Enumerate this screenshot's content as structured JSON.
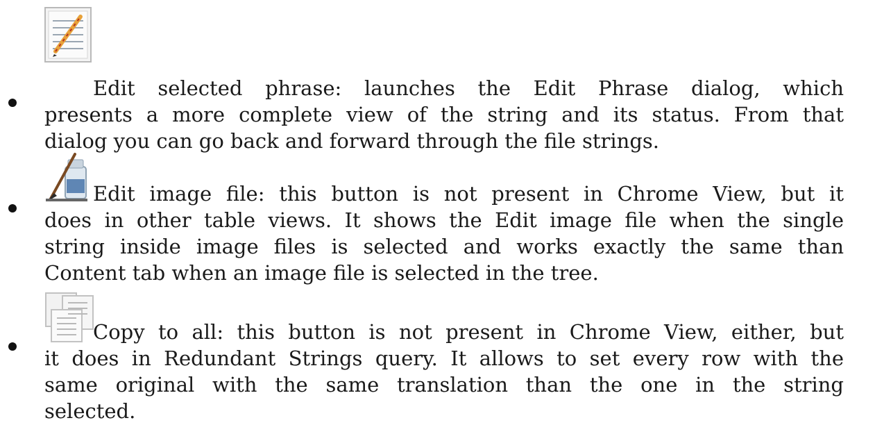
{
  "items": [
    {
      "icon": "edit-phrase-icon",
      "lines": [
        "Edit selected phrase: launches the Edit Phrase dialog, which",
        "presents a more complete view of the string and its status. From that",
        "dialog you can go back and forward through the file strings."
      ]
    },
    {
      "icon": "edit-image-file-icon",
      "lines": [
        "Edit image file: this button is not present in Chrome View, but it",
        "does in other table views. It shows the Edit image file when the single",
        "string inside image files is selected and works exactly the same than",
        "Content tab when an image file is selected in the tree."
      ]
    },
    {
      "icon": "copy-to-all-icon",
      "lines": [
        "Copy to all: this button is not present in Chrome View, either, but",
        "it does in Redundant Strings query. It allows to set every row with the",
        "same original with the same translation than the one in the string",
        "selected."
      ]
    }
  ]
}
